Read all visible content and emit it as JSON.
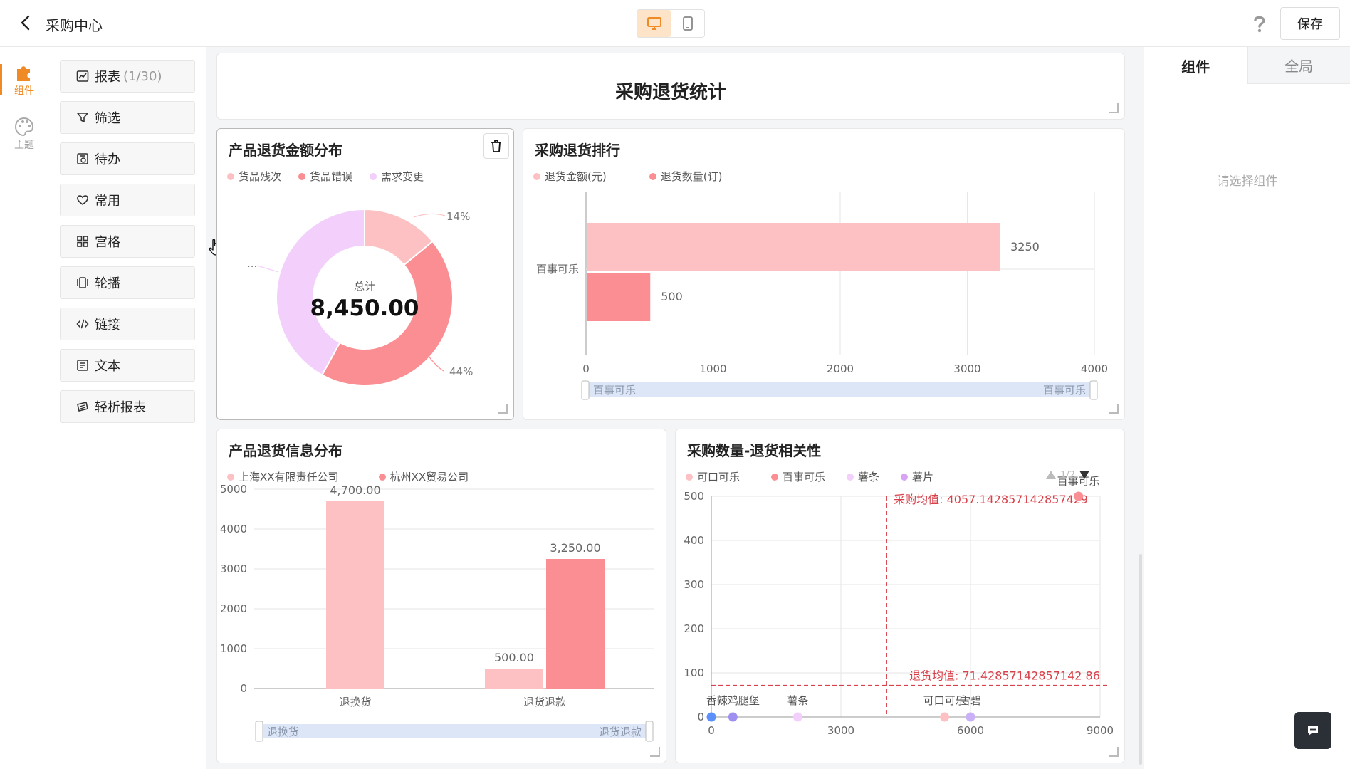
{
  "header": {
    "title": "采购中心",
    "save_label": "保存"
  },
  "rail": [
    {
      "label": "组件",
      "active": true
    },
    {
      "label": "主题",
      "active": false
    }
  ],
  "palette": [
    {
      "label": "报表",
      "count": "(1/30)",
      "icon": "report-icon"
    },
    {
      "label": "筛选",
      "icon": "filter-icon"
    },
    {
      "label": "待办",
      "icon": "todo-icon"
    },
    {
      "label": "常用",
      "icon": "heart-icon"
    },
    {
      "label": "宫格",
      "icon": "grid-icon"
    },
    {
      "label": "轮播",
      "icon": "carousel-icon"
    },
    {
      "label": "链接",
      "icon": "code-icon"
    },
    {
      "label": "文本",
      "icon": "text-icon"
    },
    {
      "label": "轻析报表",
      "icon": "light-report-icon"
    }
  ],
  "canvas": {
    "page_title": "采购退货统计"
  },
  "colors": {
    "pink_light": "#fec1c3",
    "pink_dark": "#fa8e92",
    "lavender": "#f3cffb",
    "blue": "#5b8ff9",
    "violet": "#c9b0f7",
    "accent": "#f08a24",
    "mean_line": "#d9414a"
  },
  "chart_data": [
    {
      "type": "pie",
      "title": "产品退货金额分布",
      "legend": [
        "货品残次",
        "货品错误",
        "需求变更"
      ],
      "center_label": "总计",
      "center_value": "8,450.00",
      "slices": [
        {
          "name": "货品残次",
          "percent": 14,
          "label": "14%"
        },
        {
          "name": "货品错误",
          "percent": 44,
          "label": "44%"
        },
        {
          "name": "需求变更",
          "percent": 42,
          "label": "..."
        }
      ]
    },
    {
      "type": "bar",
      "orientation": "horizontal",
      "title": "采购退货排行",
      "legend": [
        "退货金额(元)",
        "退货数量(订)"
      ],
      "categories": [
        "百事可乐"
      ],
      "series": [
        {
          "name": "退货金额(元)",
          "values": [
            3250
          ]
        },
        {
          "name": "退货数量(订)",
          "values": [
            500
          ]
        }
      ],
      "xlim": [
        0,
        4000
      ],
      "ticks": [
        "0",
        "1000",
        "2000",
        "3000",
        "4000"
      ],
      "slider": {
        "start": "百事可乐",
        "end": "百事可乐"
      }
    },
    {
      "type": "bar",
      "title": "产品退货信息分布",
      "legend": [
        "上海XX有限责任公司",
        "杭州XX贸易公司"
      ],
      "categories": [
        "退换货",
        "退货退款"
      ],
      "series": [
        {
          "name": "上海XX有限责任公司",
          "values": [
            4700,
            500
          ]
        },
        {
          "name": "杭州XX贸易公司",
          "values": [
            0,
            3250
          ]
        }
      ],
      "value_labels": [
        [
          "4,700.00",
          "500.00"
        ],
        [
          "",
          "3,250.00"
        ]
      ],
      "ylim": [
        0,
        5000
      ],
      "ticks": [
        "0",
        "1000",
        "2000",
        "3000",
        "4000",
        "5000"
      ],
      "slider": {
        "start": "退换货",
        "end": "退货退款"
      }
    },
    {
      "type": "scatter",
      "title": "采购数量-退货相关性",
      "legend": [
        "可口可乐",
        "百事可乐",
        "薯条",
        "薯片"
      ],
      "pager": "1/2",
      "x_ticks": [
        "0",
        "3000",
        "6000",
        "9000"
      ],
      "y_ticks": [
        "0",
        "100",
        "200",
        "300",
        "400",
        "500"
      ],
      "xlim": [
        0,
        9000
      ],
      "ylim": [
        0,
        500
      ],
      "points": [
        {
          "x": 0,
          "y": 0,
          "label": "",
          "color": "#5b8ff9"
        },
        {
          "x": 500,
          "y": 0,
          "label": "香辣鸡腿堡",
          "color": "#9f8ff0"
        },
        {
          "x": 2000,
          "y": 0,
          "label": "薯条",
          "color": "#f3cffb"
        },
        {
          "x": 5400,
          "y": 0,
          "label": "可口可乐",
          "color": "#fec1c3"
        },
        {
          "x": 6000,
          "y": 0,
          "label": "雪碧",
          "color": "#c9b0f7"
        },
        {
          "x": 8500,
          "y": 500,
          "label": "百事可乐",
          "color": "#fa8e92"
        }
      ],
      "x_mean": 4057.142857142857,
      "x_mean_label": "采购均值: 4057.142857142857429",
      "y_mean": 71.42857142857143,
      "y_mean_label": "退货均值: 71.42857142857142 86"
    }
  ],
  "right_panel": {
    "tabs": [
      "组件",
      "全局"
    ],
    "empty_text": "请选择组件"
  }
}
